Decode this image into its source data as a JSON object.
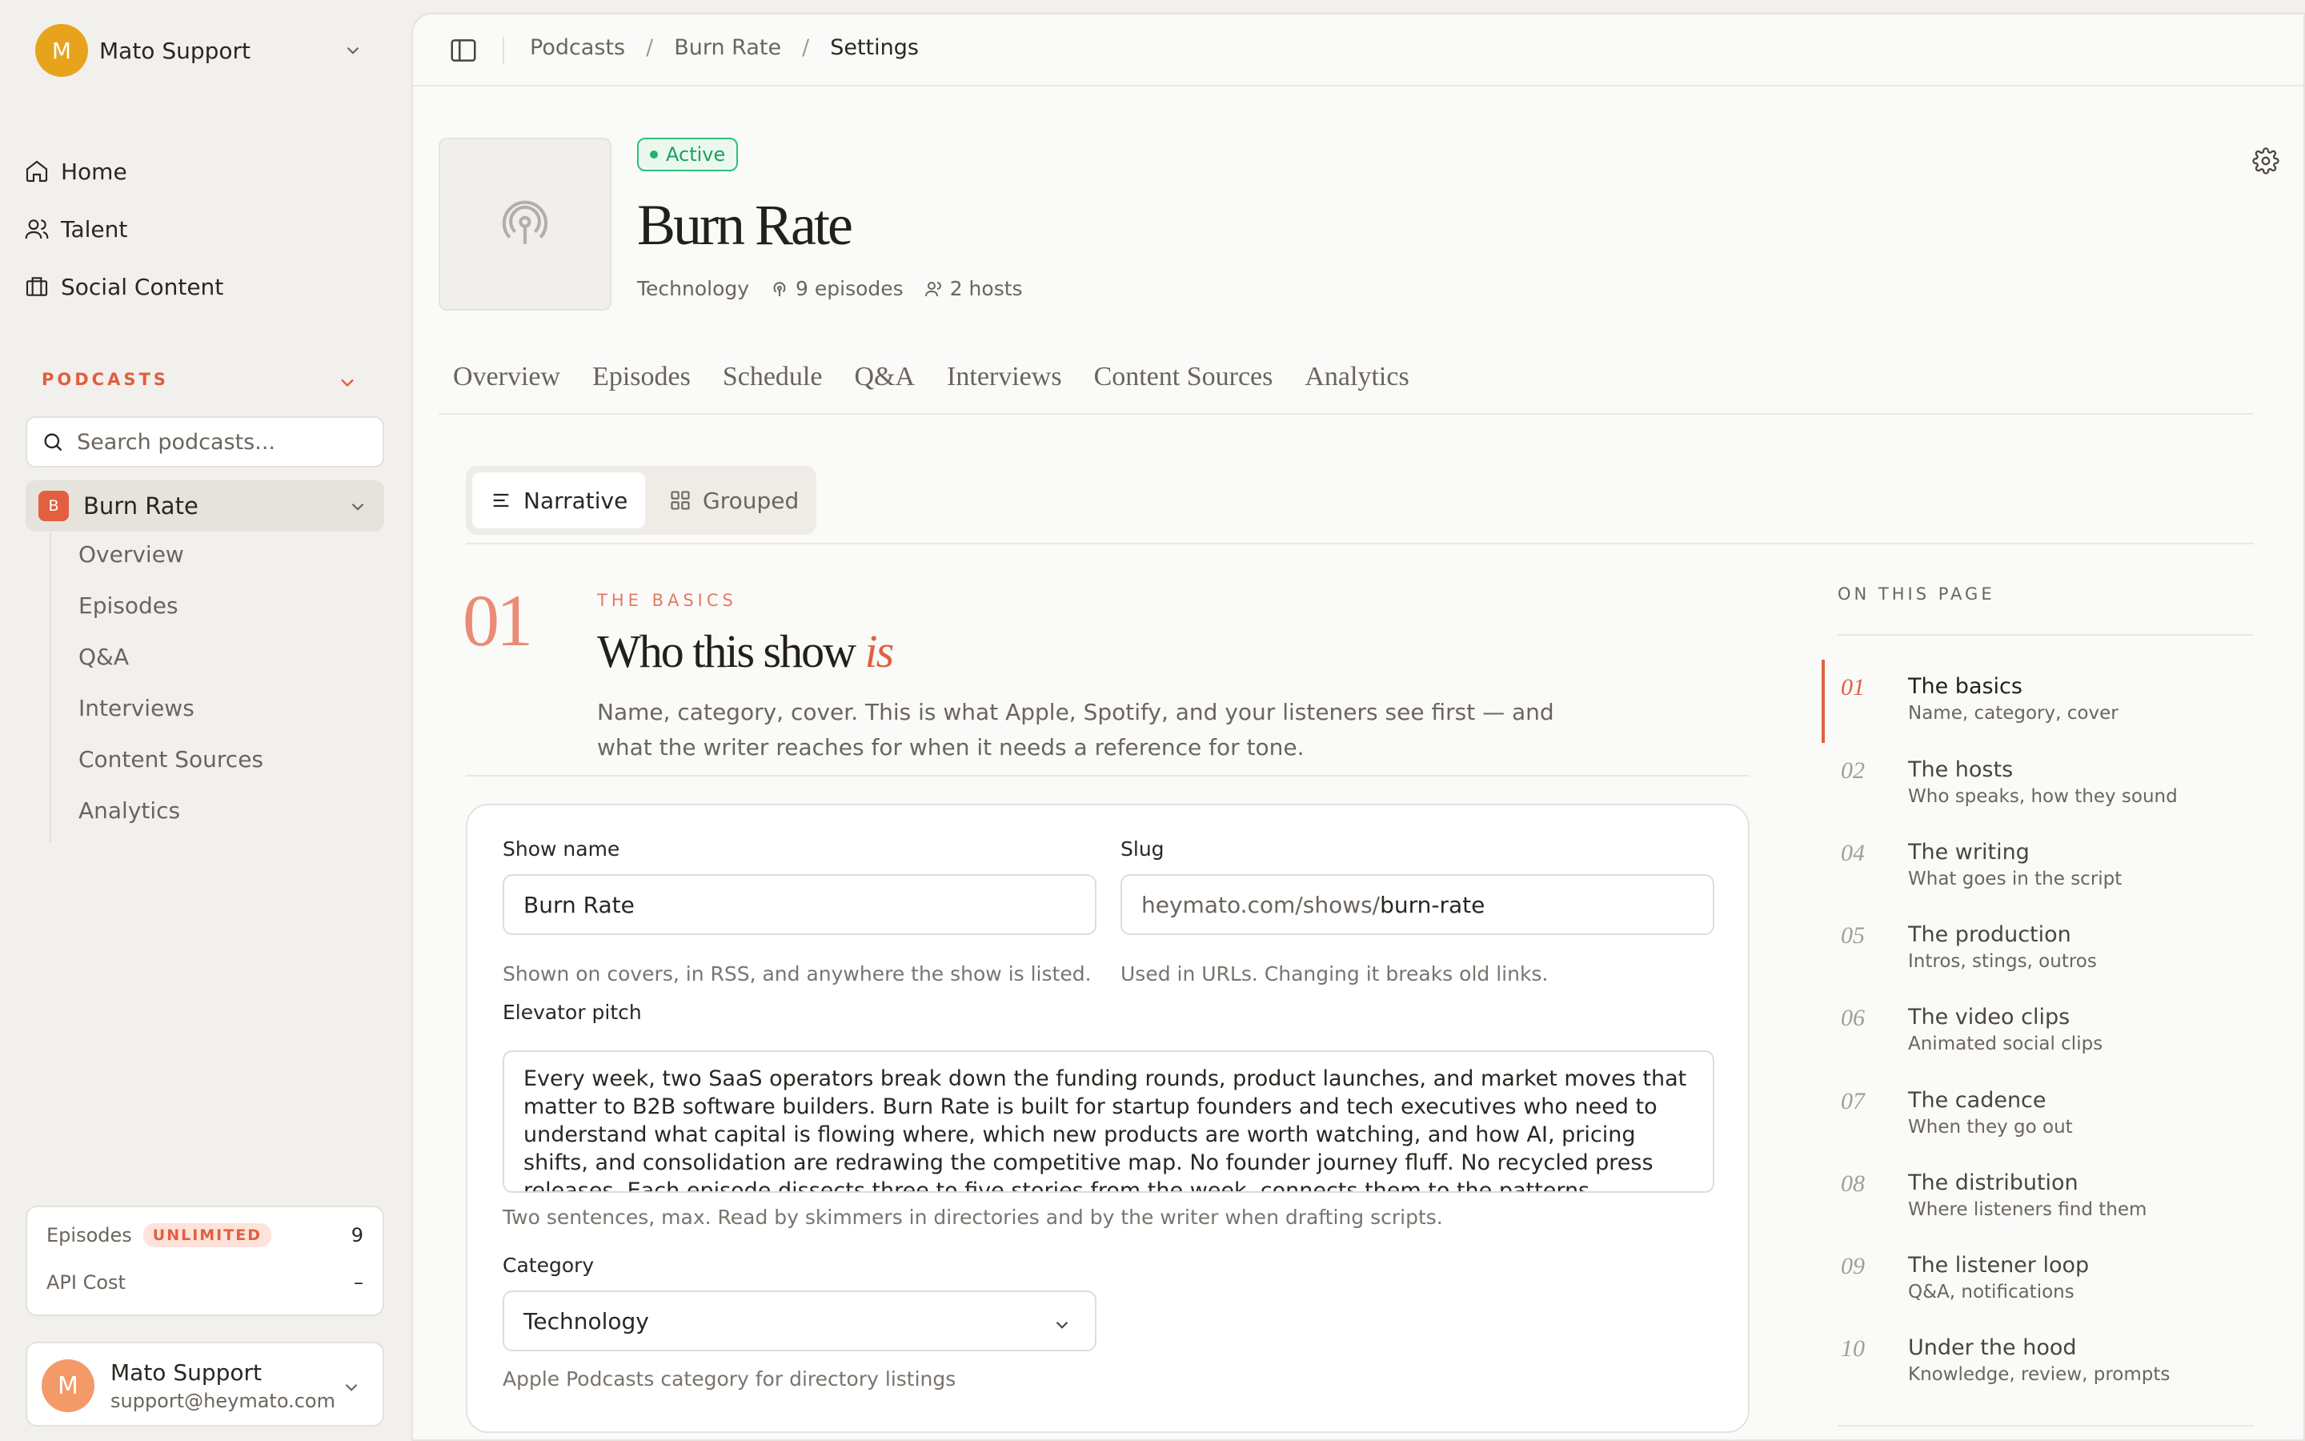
{
  "workspace": {
    "initial": "M",
    "name": "Mato Support"
  },
  "nav": [
    {
      "label": "Home",
      "icon": "home-icon"
    },
    {
      "label": "Talent",
      "icon": "users-icon"
    },
    {
      "label": "Social Content",
      "icon": "briefcase-icon"
    }
  ],
  "podcasts_section": {
    "label": "PODCASTS",
    "search_placeholder": "Search podcasts...",
    "selected": {
      "badge": "B",
      "name": "Burn Rate"
    },
    "sub_items": [
      "Overview",
      "Episodes",
      "Q&A",
      "Interviews",
      "Content Sources",
      "Analytics"
    ]
  },
  "usage": {
    "episodes_label": "Episodes",
    "episodes_badge": "UNLIMITED",
    "episodes_value": "9",
    "api_label": "API Cost",
    "api_value": "–"
  },
  "user": {
    "initial": "M",
    "name": "Mato Support",
    "email": "support@heymato.com"
  },
  "breadcrumb": {
    "items": [
      "Podcasts",
      "Burn Rate"
    ],
    "current": "Settings"
  },
  "podcast": {
    "status": "Active",
    "title": "Burn Rate",
    "category": "Technology",
    "episodes": "9 episodes",
    "hosts": "2 hosts"
  },
  "tabs": [
    "Overview",
    "Episodes",
    "Schedule",
    "Q&A",
    "Interviews",
    "Content Sources",
    "Analytics"
  ],
  "view_toggle": {
    "narrative": "Narrative",
    "grouped": "Grouped",
    "selected": "Narrative"
  },
  "section": {
    "number": "01",
    "eyebrow": "THE BASICS",
    "title_main": "Who this show ",
    "title_em": "is",
    "description": "Name, category, cover. This is what Apple, Spotify, and your listeners see first — and what the writer reaches for when it needs a reference for tone."
  },
  "form": {
    "show_name_label": "Show name",
    "show_name_value": "Burn Rate",
    "show_name_help": "Shown on covers, in RSS, and anywhere the show is listed.",
    "slug_label": "Slug",
    "slug_prefix": "heymato.com/shows/",
    "slug_value": "burn-rate",
    "slug_help": "Used in URLs. Changing it breaks old links.",
    "pitch_label": "Elevator pitch",
    "pitch_value": "Every week, two SaaS operators break down the funding rounds, product launches, and market moves that matter to B2B software builders. Burn Rate is built for startup founders and tech executives who need to understand what capital is flowing where, which new products are worth watching, and how AI, pricing shifts, and consolidation are redrawing the competitive map. No founder journey fluff. No recycled press releases. Each episode dissects three to five stories from the week, connects them to the patterns underneath, and",
    "pitch_help": "Two sentences, max. Read by skimmers in directories and by the writer when drafting scripts.",
    "category_label": "Category",
    "category_value": "Technology",
    "category_help": "Apple Podcasts category for directory listings"
  },
  "toc": {
    "heading": "ON THIS PAGE",
    "current": "01",
    "items": [
      {
        "num": "01",
        "title": "The basics",
        "sub": "Name, category, cover"
      },
      {
        "num": "02",
        "title": "The hosts",
        "sub": "Who speaks, how they sound"
      },
      {
        "num": "04",
        "title": "The writing",
        "sub": "What goes in the script"
      },
      {
        "num": "05",
        "title": "The production",
        "sub": "Intros, stings, outros"
      },
      {
        "num": "06",
        "title": "The video clips",
        "sub": "Animated social clips"
      },
      {
        "num": "07",
        "title": "The cadence",
        "sub": "When they go out"
      },
      {
        "num": "08",
        "title": "The distribution",
        "sub": "Where listeners find them"
      },
      {
        "num": "09",
        "title": "The listener loop",
        "sub": "Q&A, notifications"
      },
      {
        "num": "10",
        "title": "Under the hood",
        "sub": "Knowledge, review, prompts"
      }
    ]
  },
  "colors": {
    "accent": "#e2603f",
    "active_green": "#22b26c",
    "workspace_avatar": "#e8a31c",
    "user_avatar": "#f39a68"
  }
}
